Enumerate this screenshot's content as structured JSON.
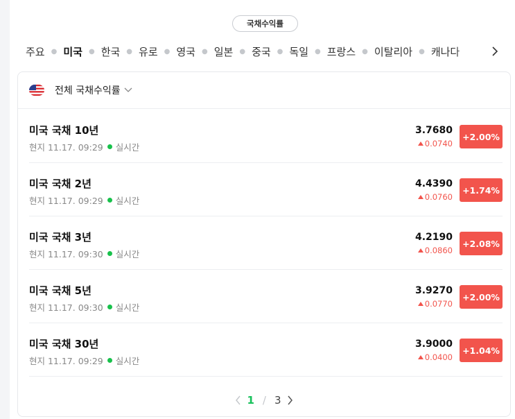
{
  "header": {
    "pill_label": "국채수익률"
  },
  "tabs": [
    {
      "label": "주요",
      "active": false
    },
    {
      "label": "미국",
      "active": true
    },
    {
      "label": "한국",
      "active": false
    },
    {
      "label": "유로",
      "active": false
    },
    {
      "label": "영국",
      "active": false
    },
    {
      "label": "일본",
      "active": false
    },
    {
      "label": "중국",
      "active": false
    },
    {
      "label": "독일",
      "active": false
    },
    {
      "label": "프랑스",
      "active": false
    },
    {
      "label": "이탈리아",
      "active": false
    },
    {
      "label": "캐나다",
      "active": false
    }
  ],
  "card": {
    "title": "전체 국채수익률",
    "rows": [
      {
        "name": "미국 국채 10년",
        "local": "현지 11.17. 09:29",
        "live": "실시간",
        "value": "3.7680",
        "change": "0.0740",
        "pct": "+2.00%"
      },
      {
        "name": "미국 국채 2년",
        "local": "현지 11.17. 09:29",
        "live": "실시간",
        "value": "4.4390",
        "change": "0.0760",
        "pct": "+1.74%"
      },
      {
        "name": "미국 국채 3년",
        "local": "현지 11.17. 09:30",
        "live": "실시간",
        "value": "4.2190",
        "change": "0.0860",
        "pct": "+2.08%"
      },
      {
        "name": "미국 국채 5년",
        "local": "현지 11.17. 09:30",
        "live": "실시간",
        "value": "3.9270",
        "change": "0.0770",
        "pct": "+2.00%"
      },
      {
        "name": "미국 국채 30년",
        "local": "현지 11.17. 09:29",
        "live": "실시간",
        "value": "3.9000",
        "change": "0.0400",
        "pct": "+1.04%"
      }
    ]
  },
  "pager": {
    "current": "1",
    "separator": "/",
    "total": "3"
  },
  "colors": {
    "up": "#f2544c",
    "active_page": "#16c15a",
    "live": "#18c14b"
  }
}
